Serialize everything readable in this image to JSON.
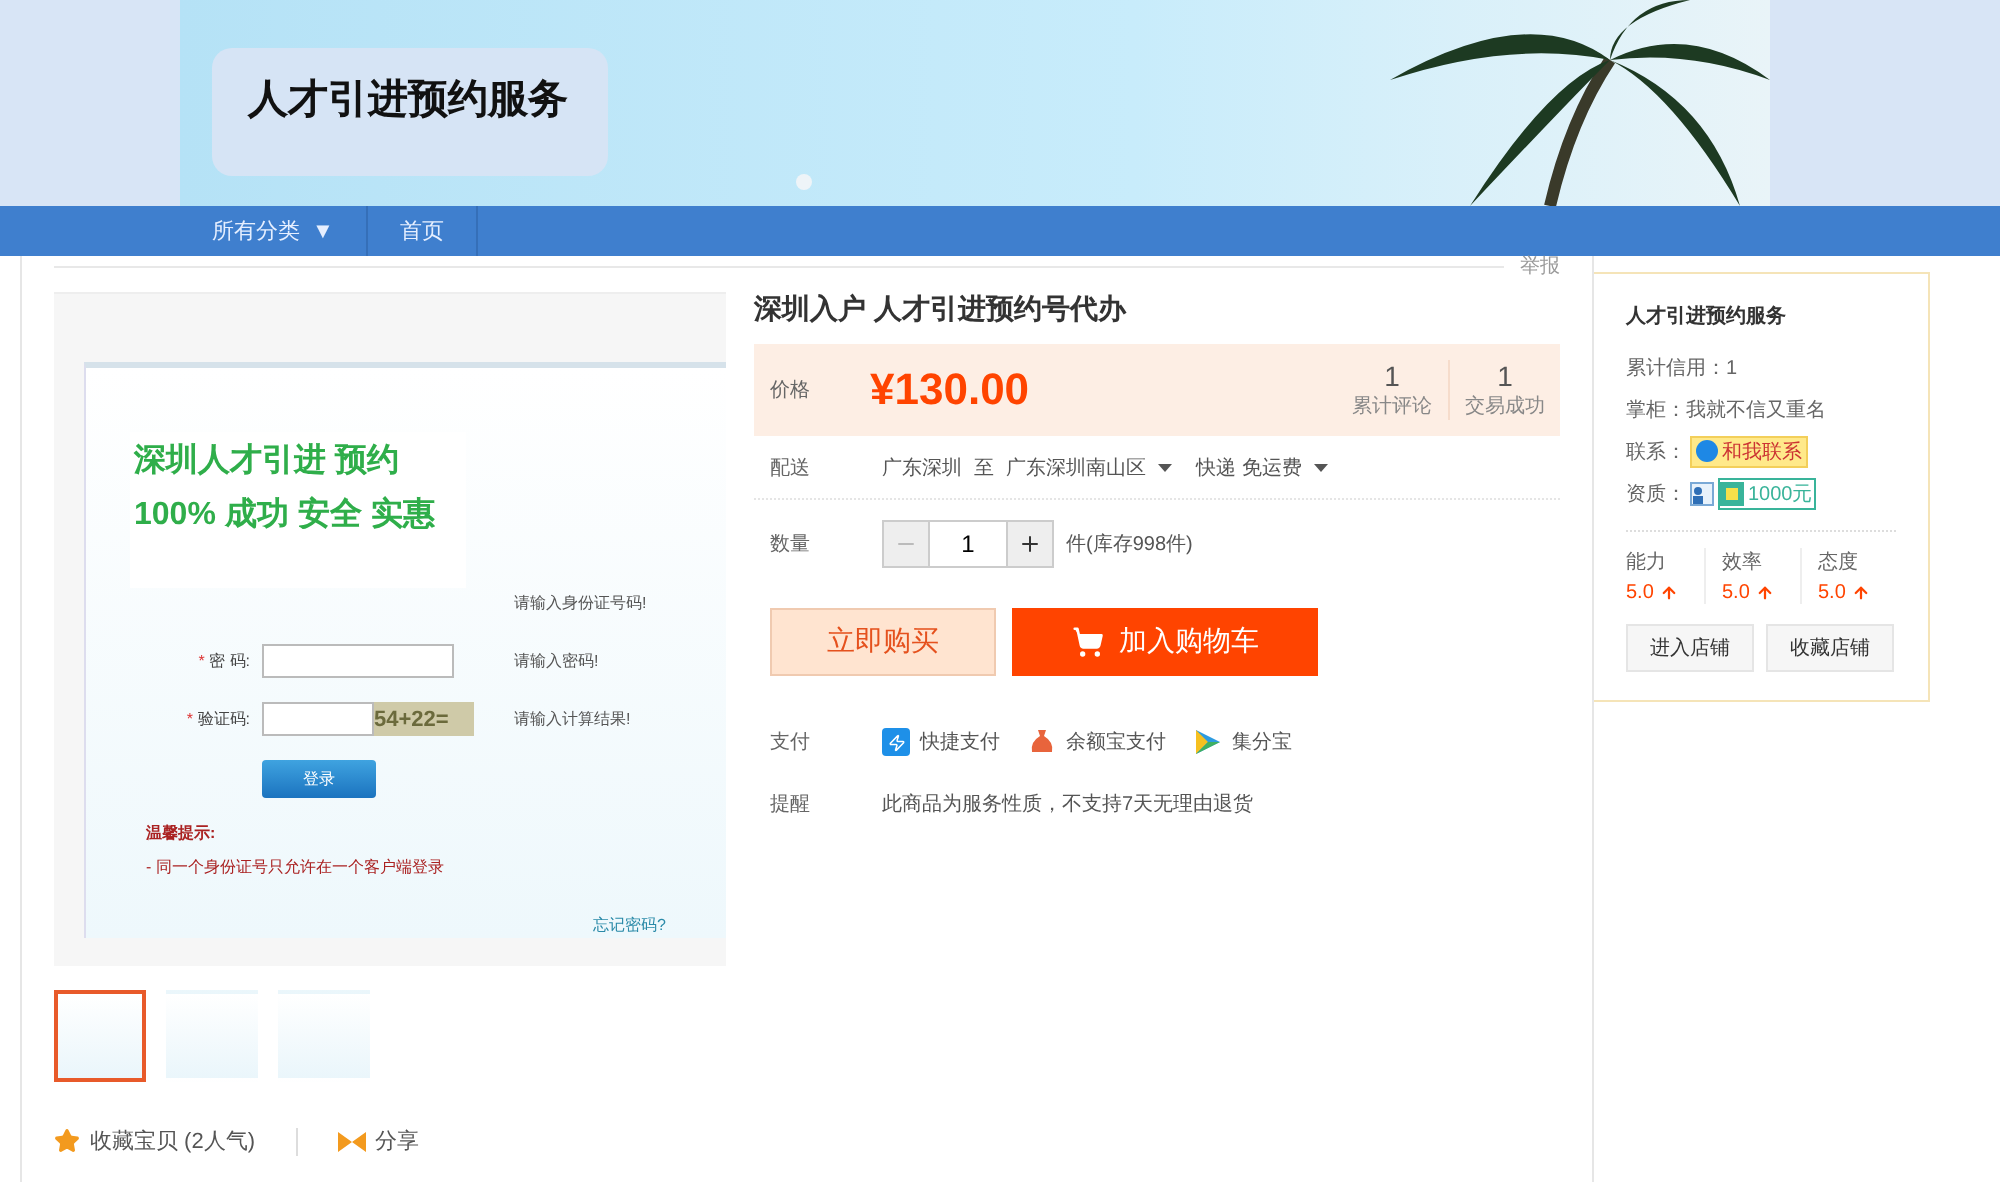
{
  "banner": {
    "title": "人才引进预约服务"
  },
  "nav": [
    {
      "label": "所有分类",
      "caret": "▼"
    },
    {
      "label": "首页"
    }
  ],
  "report": "举报",
  "gallery": {
    "overlay": [
      "深圳人才引进 预约",
      "100% 成功 安全 实惠"
    ],
    "form": [
      {
        "kind": "hint",
        "hint": "请输入身份证号码!"
      },
      {
        "kind": "input",
        "mark": "*",
        "label": "密 码:",
        "hint": "请输入密码!"
      },
      {
        "kind": "captcha",
        "mark": "*",
        "label": "验证码:",
        "captcha": "54+22=",
        "hint": "请输入计算结果!"
      }
    ],
    "login": "登录",
    "tip_title": "温馨提示:",
    "tip": "- 同一个身份证号只允许在一个客户端登录",
    "forgot": "忘记密码?",
    "thumbnails": [
      {
        "selected": true
      },
      {
        "selected": false
      },
      {
        "selected": false
      }
    ]
  },
  "favorite": "收藏宝贝 (2人气)",
  "share": "分享",
  "product": {
    "title": "深圳入户 人才引进预约号代办",
    "price_label": "价格",
    "currency": "¥",
    "price": "130.00",
    "stats": [
      {
        "value": "1",
        "label": "累计评论"
      },
      {
        "value": "1",
        "label": "交易成功"
      }
    ],
    "delivery": {
      "label": "配送",
      "from": "广东深圳",
      "to_word": "至",
      "to": "广东深圳南山区",
      "method": "快递 免运费"
    },
    "quantity": {
      "label": "数量",
      "value": "1",
      "stock": "件(库存998件)"
    },
    "buy": "立即购买",
    "cart": "加入购物车",
    "payment": {
      "label": "支付",
      "methods": [
        {
          "kind": "quick",
          "label": "快捷支付"
        },
        {
          "kind": "balance",
          "label": "余额宝支付"
        },
        {
          "kind": "points",
          "label": "集分宝"
        }
      ]
    },
    "reminder": {
      "label": "提醒",
      "text": "此商品为服务性质，不支持7天无理由退货"
    }
  },
  "shop": {
    "name": "人才引进预约服务",
    "credit": "累计信用：1",
    "owner": "掌柜：我就不信又重名",
    "contact_label": "联系：",
    "contact": "和我联系",
    "qual_label": "资质：",
    "deposit": "1000元",
    "ratings": [
      {
        "label": "能力",
        "score": "5.0"
      },
      {
        "label": "效率",
        "score": "5.0"
      },
      {
        "label": "态度",
        "score": "5.0"
      }
    ],
    "buttons": [
      "进入店铺",
      "收藏店铺"
    ]
  }
}
